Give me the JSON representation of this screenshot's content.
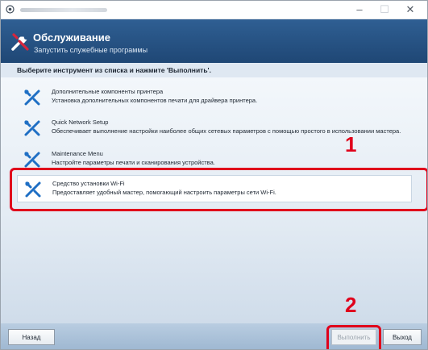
{
  "window": {
    "close_glyph": "✕",
    "minimize_glyph": "–",
    "maximize_glyph": "☐"
  },
  "header": {
    "title": "Обслуживание",
    "subtitle": "Запустить служебные программы",
    "icon": "tools-icon"
  },
  "instruction": "Выберите инструмент из списка и нажмите 'Выполнить'.",
  "tools": [
    {
      "name": "Дополнительные компоненты принтера",
      "description": "Установка дополнительных компонентов печати для драйвера принтера.",
      "icon": "wrench-screwdriver-icon"
    },
    {
      "name": "Quick Network Setup",
      "description": "Обеспечивает выполнение настройки наиболее общих сетевых параметров с помощью простого в использовании мастера.",
      "icon": "wrench-screwdriver-icon"
    },
    {
      "name": "Maintenance Menu",
      "description": "Настройте параметры печати и сканирования устройства.",
      "icon": "wrench-screwdriver-icon"
    },
    {
      "name": "Средство установки Wi-Fi",
      "description": "Предоставляет удобный мастер, помогающий настроить параметры сети Wi-Fi.",
      "icon": "wrench-screwdriver-icon",
      "selected": true
    }
  ],
  "callouts": {
    "step1": "1",
    "step2": "2",
    "color": "#e0001b"
  },
  "footer": {
    "back_label": "Назад",
    "run_label": "Выполнить",
    "exit_label": "Выход"
  },
  "colors": {
    "header_bg": "#2a5685",
    "accent_icon": "#1f6fc4",
    "callout": "#e0001b"
  }
}
